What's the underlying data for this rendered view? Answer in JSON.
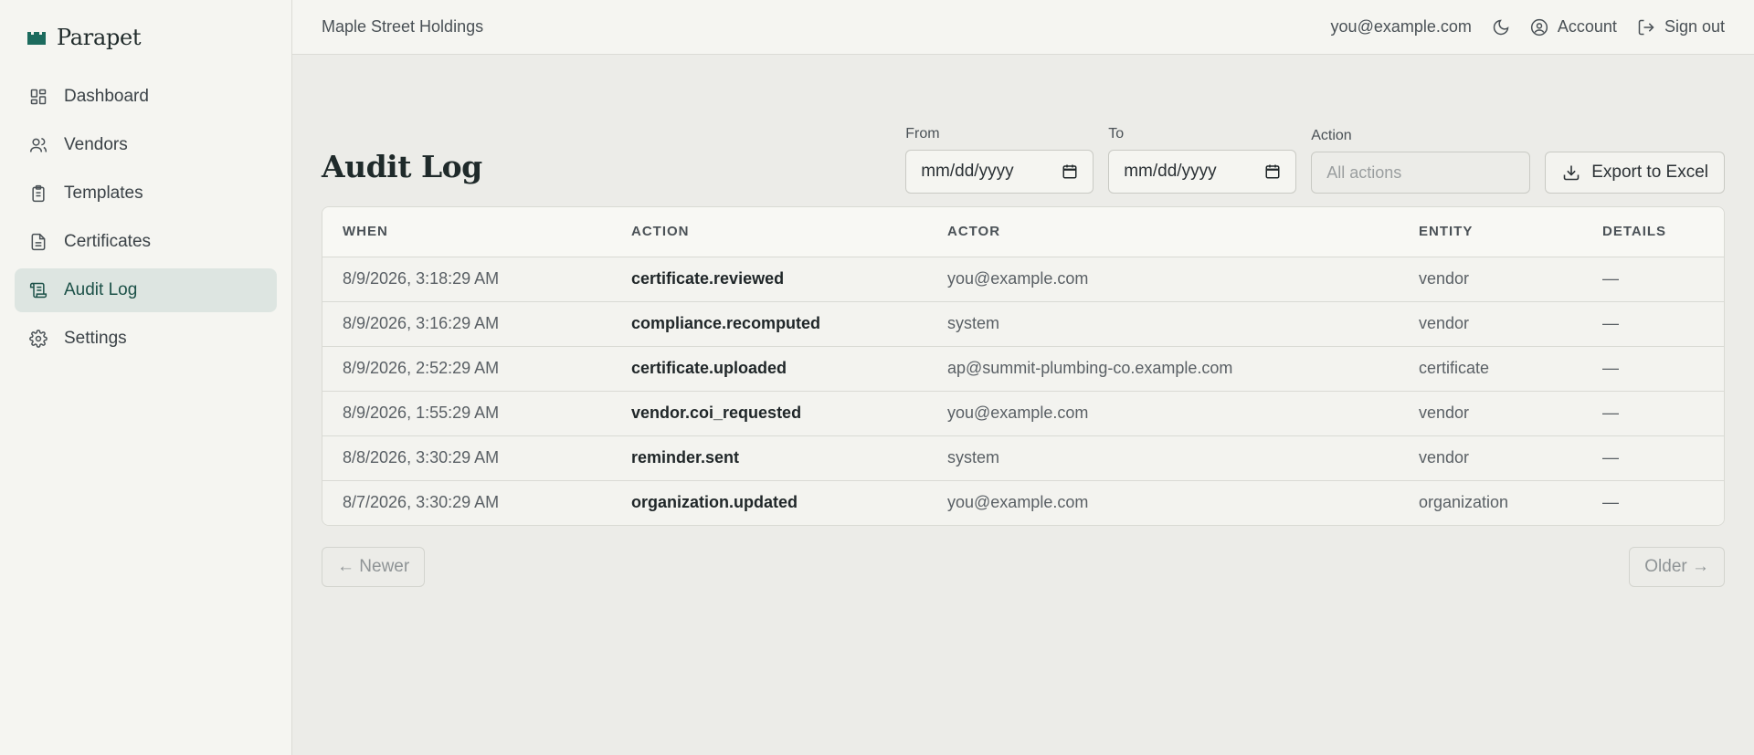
{
  "brand": {
    "name": "Parapet",
    "logo_icon": "castle-icon",
    "accent": "#1c6b5e"
  },
  "sidebar": {
    "items": [
      {
        "label": "Dashboard",
        "icon": "dashboard-icon",
        "active": false
      },
      {
        "label": "Vendors",
        "icon": "users-icon",
        "active": false
      },
      {
        "label": "Templates",
        "icon": "clipboard-icon",
        "active": false
      },
      {
        "label": "Certificates",
        "icon": "document-icon",
        "active": false
      },
      {
        "label": "Audit Log",
        "icon": "scroll-icon",
        "active": true
      },
      {
        "label": "Settings",
        "icon": "gear-icon",
        "active": false
      }
    ]
  },
  "topbar": {
    "org_name": "Maple Street Holdings",
    "user_email": "you@example.com",
    "theme_icon": "moon-icon",
    "account_label": "Account",
    "signout_label": "Sign out"
  },
  "page": {
    "title": "Audit Log"
  },
  "filters": {
    "from_label": "From",
    "from_value": "mm/dd/yyyy",
    "to_label": "To",
    "to_value": "mm/dd/yyyy",
    "action_label": "Action",
    "action_placeholder": "All actions",
    "export_label": "Export to Excel"
  },
  "table": {
    "columns": [
      "WHEN",
      "ACTION",
      "ACTOR",
      "ENTITY",
      "DETAILS"
    ],
    "rows": [
      {
        "when": "8/9/2026, 3:18:29 AM",
        "action": "certificate.reviewed",
        "actor": "you@example.com",
        "entity": "vendor",
        "details": "—"
      },
      {
        "when": "8/9/2026, 3:16:29 AM",
        "action": "compliance.recomputed",
        "actor": "system",
        "entity": "vendor",
        "details": "—"
      },
      {
        "when": "8/9/2026, 2:52:29 AM",
        "action": "certificate.uploaded",
        "actor": "ap@summit-plumbing-co.example.com",
        "entity": "certificate",
        "details": "—"
      },
      {
        "when": "8/9/2026, 1:55:29 AM",
        "action": "vendor.coi_requested",
        "actor": "you@example.com",
        "entity": "vendor",
        "details": "—"
      },
      {
        "when": "8/8/2026, 3:30:29 AM",
        "action": "reminder.sent",
        "actor": "system",
        "entity": "vendor",
        "details": "—"
      },
      {
        "when": "8/7/2026, 3:30:29 AM",
        "action": "organization.updated",
        "actor": "you@example.com",
        "entity": "organization",
        "details": "—"
      }
    ]
  },
  "pager": {
    "newer_label": "← Newer",
    "older_label": "Older →"
  }
}
